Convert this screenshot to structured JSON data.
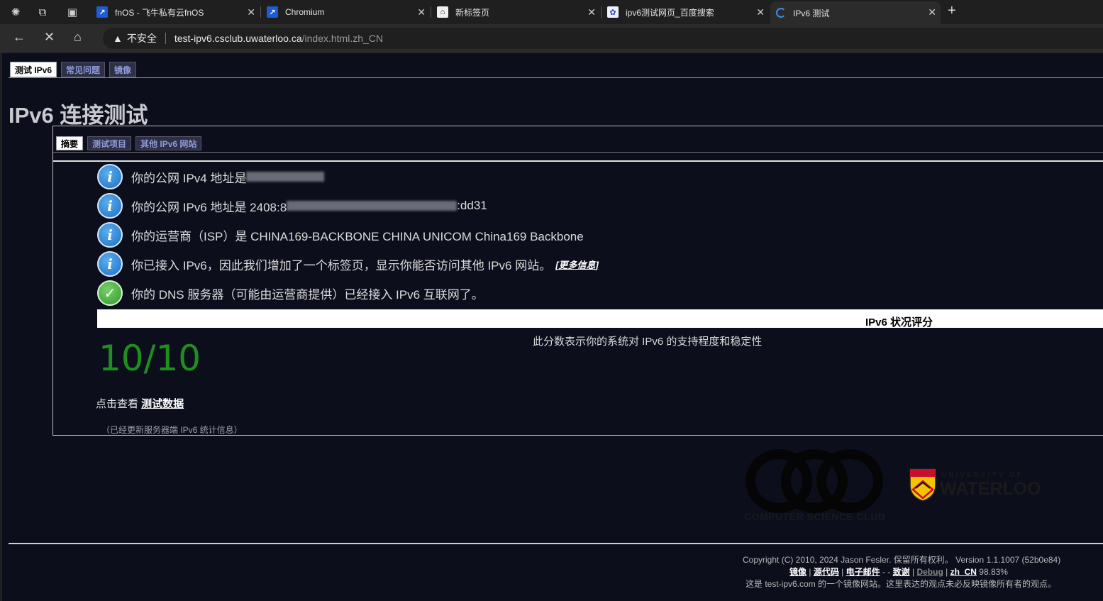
{
  "browser": {
    "tabs": [
      {
        "title": "fnOS - 飞牛私有云fnOS",
        "icon": "fnos-icon"
      },
      {
        "title": "Chromium",
        "icon": "fnos-icon"
      },
      {
        "title": "新标签页",
        "icon": "newtab-icon"
      },
      {
        "title": "ipv6测试网页_百度搜索",
        "icon": "baidu-icon"
      },
      {
        "title": "IPv6 测试",
        "icon": "loading-icon"
      }
    ],
    "security_label": "不安全",
    "url_host": "test-ipv6.csclub.uwaterloo.ca",
    "url_path": "/index.html.zh_CN"
  },
  "page": {
    "top_tabs": [
      "测试 IPv6",
      "常见问题",
      "镜像"
    ],
    "title": "IPv6 连接测试",
    "sub_tabs": [
      "摘要",
      "测试项目",
      "其他 IPv6 网站"
    ],
    "results": [
      {
        "icon": "info-icon",
        "text": "你的公网 IPv4 地址是 ",
        "tail": ""
      },
      {
        "icon": "info-icon",
        "text": "你的公网 IPv6 地址是 2408:8",
        "tail": ":dd31"
      },
      {
        "icon": "info-icon",
        "text": "你的运营商（ISP）是 CHINA169-BACKBONE CHINA UNICOM China169 Backbone",
        "tail": ""
      },
      {
        "icon": "info-icon",
        "text": "你已接入 IPv6，因此我们增加了一个标签页，显示你能否访问其他 IPv6 网站。",
        "more": "[更多信息]"
      },
      {
        "icon": "check-icon",
        "text": "你的 DNS 服务器（可能由运营商提供）已经接入 IPv6 互联网了。"
      }
    ],
    "score_title": "IPv6 状况评分",
    "score_desc": "此分数表示你的系统对 IPv6 的支持程度和稳定性",
    "score": "10/10",
    "see_data_prefix": "点击查看 ",
    "see_data_link": "测试数据",
    "updated_note": "（已经更新服务器端 IPv6 统计信息）",
    "csc_logo_text": "COMPUTER SCIENCE CLUB",
    "uw_logo_small": "UNIVERSITY OF",
    "uw_logo_big": "WATERLOO",
    "footer": {
      "copyright": "Copyright (C) 2010, 2024 Jason Fesler. 保留所有权利。 Version 1.1.1007 (52b0e84)",
      "links": [
        "镜像",
        "源代码",
        "电子邮件",
        "致谢",
        "Debug",
        "zh_CN"
      ],
      "percent": "98.83%",
      "mirror_note": "这是 test-ipv6.com 的一个镜像网站。这里表达的观点未必反映镜像所有者的观点。"
    }
  }
}
